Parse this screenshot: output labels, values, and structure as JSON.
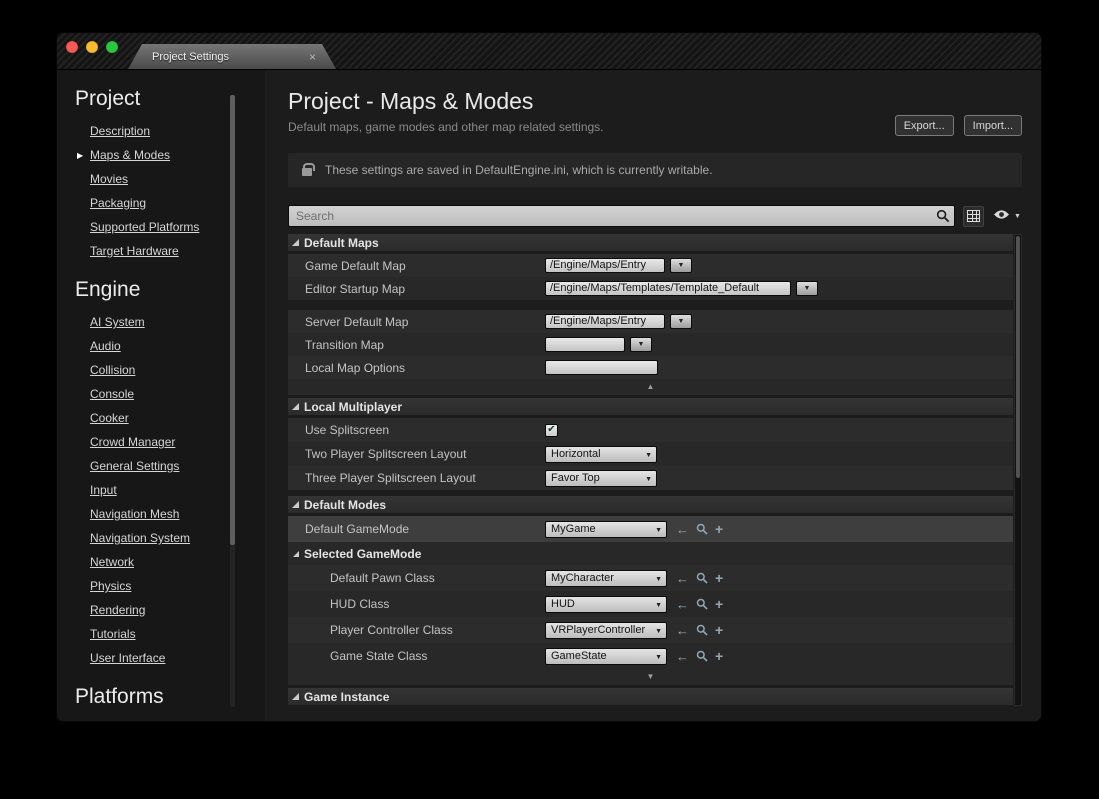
{
  "window": {
    "tab_title": "Project Settings",
    "tab_close": "×"
  },
  "sidebar": {
    "project": {
      "title": "Project",
      "items": [
        "Description",
        "Maps & Modes",
        "Movies",
        "Packaging",
        "Supported Platforms",
        "Target Hardware"
      ],
      "selected": "Maps & Modes"
    },
    "engine": {
      "title": "Engine",
      "items": [
        "AI System",
        "Audio",
        "Collision",
        "Console",
        "Cooker",
        "Crowd Manager",
        "General Settings",
        "Input",
        "Navigation Mesh",
        "Navigation System",
        "Network",
        "Physics",
        "Rendering",
        "Tutorials",
        "User Interface"
      ]
    },
    "platforms": {
      "title": "Platforms"
    }
  },
  "header": {
    "title": "Project - Maps & Modes",
    "subtitle": "Default maps, game modes and other map related settings.",
    "export_button": "Export...",
    "import_button": "Import..."
  },
  "notice": {
    "text": "These settings are saved in DefaultEngine.ini, which is currently writable."
  },
  "toolbar": {
    "search_placeholder": "Search"
  },
  "default_maps": {
    "title": "Default Maps",
    "game_default_map": {
      "label": "Game Default Map",
      "value": "/Engine/Maps/Entry"
    },
    "editor_startup_map": {
      "label": "Editor Startup Map",
      "value": "/Engine/Maps/Templates/Template_Default"
    },
    "server_default_map": {
      "label": "Server Default Map",
      "value": "/Engine/Maps/Entry"
    },
    "transition_map": {
      "label": "Transition Map",
      "value": ""
    },
    "local_map_options": {
      "label": "Local Map Options",
      "value": ""
    }
  },
  "local_multiplayer": {
    "title": "Local Multiplayer",
    "use_splitscreen": {
      "label": "Use Splitscreen",
      "checked": true
    },
    "two_player": {
      "label": "Two Player Splitscreen Layout",
      "value": "Horizontal"
    },
    "three_player": {
      "label": "Three Player Splitscreen Layout",
      "value": "Favor Top"
    }
  },
  "default_modes": {
    "title": "Default Modes",
    "default_gamemode": {
      "label": "Default GameMode",
      "value": "MyGame"
    },
    "selected_gamemode": {
      "title": "Selected GameMode",
      "default_pawn_class": {
        "label": "Default Pawn Class",
        "value": "MyCharacter"
      },
      "hud_class": {
        "label": "HUD Class",
        "value": "HUD"
      },
      "player_controller_class": {
        "label": "Player Controller Class",
        "value": "VRPlayerController"
      },
      "game_state_class": {
        "label": "Game State Class",
        "value": "GameState"
      }
    }
  },
  "game_instance": {
    "title": "Game Instance"
  },
  "icons": {
    "checkmark": "✔",
    "dropdown_arrow": "▼",
    "collapse_arrow": "▲",
    "expand_arrow": "▼",
    "selected_item_arrow": "▶",
    "use_selected_arrow": "←",
    "add": "+"
  },
  "colors": {
    "field": "#d2d2d2",
    "section_header": "#2e2e2e",
    "row_highlight": "#3e3e3e",
    "picker_icon": "#93a8b4"
  }
}
